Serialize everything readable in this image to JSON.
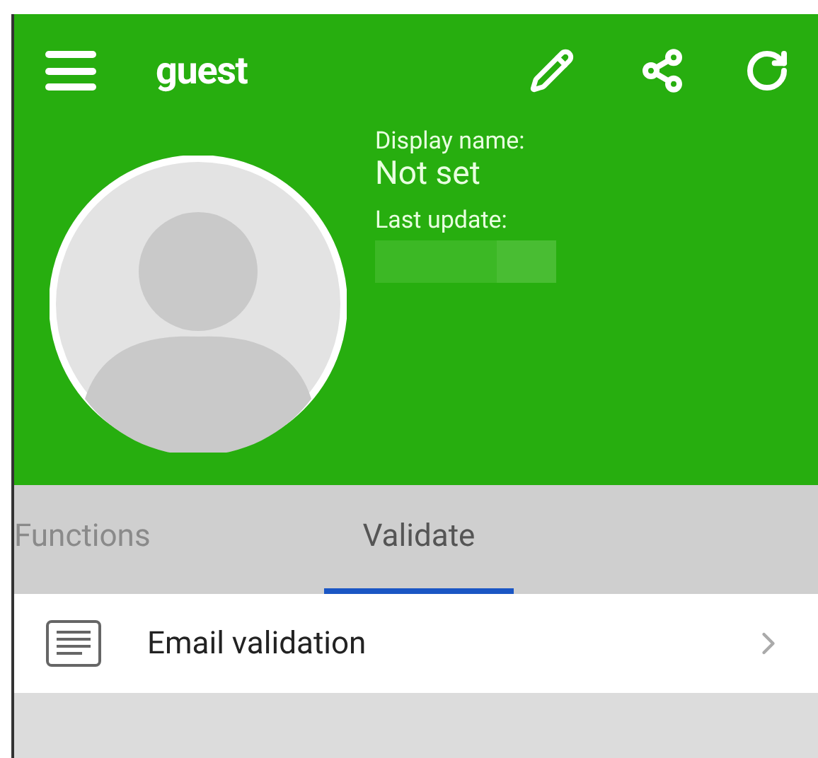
{
  "toolbar": {
    "title": "guest"
  },
  "profile": {
    "display_name_label": "Display name:",
    "display_name": "Not set",
    "last_update_label": "Last update:"
  },
  "tabs": [
    {
      "label": "Functions",
      "selected": false
    },
    {
      "label": "Validate",
      "selected": true
    }
  ],
  "items": [
    {
      "label": "Email validation"
    }
  ]
}
